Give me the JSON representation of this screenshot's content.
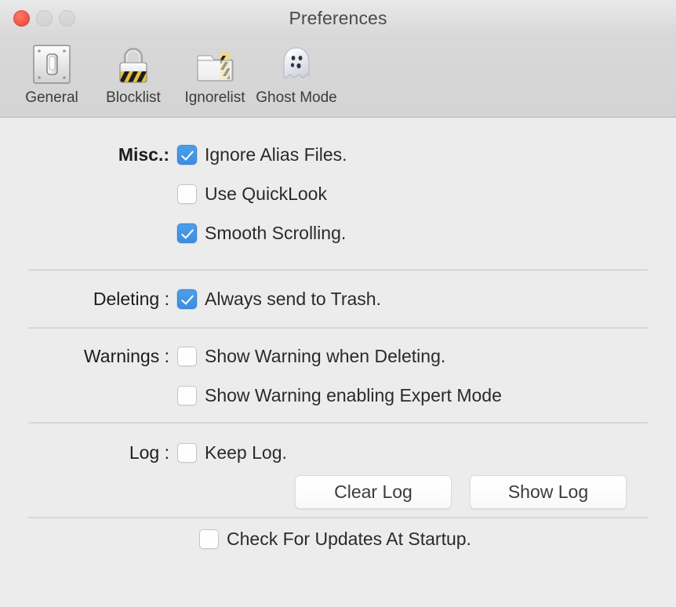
{
  "window": {
    "title": "Preferences",
    "traffic_lights": [
      {
        "name": "close",
        "color": "#f25848",
        "enabled": true
      },
      {
        "name": "minimize",
        "color": "#d6d6d6",
        "enabled": false
      },
      {
        "name": "zoom",
        "color": "#d6d6d6",
        "enabled": false
      }
    ]
  },
  "toolbar": {
    "items": [
      {
        "label": "General",
        "icon": "light-switch-icon",
        "selected": true
      },
      {
        "label": "Blocklist",
        "icon": "padlock-icon",
        "selected": false
      },
      {
        "label": "Ignorelist",
        "icon": "folder-icon",
        "selected": false
      },
      {
        "label": "Ghost Mode",
        "icon": "ghost-icon",
        "selected": false
      }
    ]
  },
  "sections": {
    "misc": {
      "label": "Misc.:",
      "options": [
        {
          "label": "Ignore Alias Files.",
          "checked": true
        },
        {
          "label": "Use QuickLook",
          "checked": false
        },
        {
          "label": "Smooth Scrolling.",
          "checked": true
        }
      ]
    },
    "deleting": {
      "label": "Deleting :",
      "options": [
        {
          "label": "Always send to Trash.",
          "checked": true
        }
      ]
    },
    "warnings": {
      "label": "Warnings :",
      "options": [
        {
          "label": "Show Warning when Deleting.",
          "checked": false
        },
        {
          "label": "Show Warning enabling Expert Mode",
          "checked": false
        }
      ]
    },
    "log": {
      "label": "Log :",
      "options": [
        {
          "label": "Keep Log.",
          "checked": false
        }
      ],
      "buttons": [
        {
          "label": "Clear Log"
        },
        {
          "label": "Show Log"
        }
      ]
    },
    "updates": {
      "options": [
        {
          "label": "Check For Updates At Startup.",
          "checked": false
        }
      ]
    }
  },
  "colors": {
    "checkbox_on": "#3b8ee0",
    "window_background": "#ececec",
    "toolbar_background": "#d5d5d5",
    "separator": "#d3d3d3"
  }
}
